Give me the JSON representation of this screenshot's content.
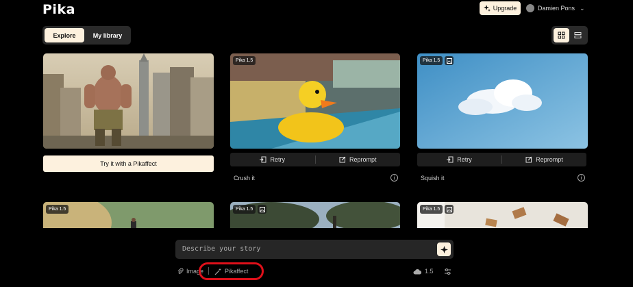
{
  "app": {
    "logo": "Pika"
  },
  "header": {
    "upgrade_label": "Upgrade",
    "user_name": "Damien Pons"
  },
  "tabs": [
    {
      "label": "Explore",
      "active": true
    },
    {
      "label": "My library",
      "active": false
    }
  ],
  "view_toggle": {
    "selected": "grid"
  },
  "cards": [
    {
      "badge": "",
      "cta_label": "Try it with a Pikaffect"
    },
    {
      "badge": "Pika 1.5",
      "has_image_icon": false,
      "retry_label": "Retry",
      "reprompt_label": "Reprompt",
      "caption": "Crush it"
    },
    {
      "badge": "Pika 1.5",
      "has_image_icon": true,
      "retry_label": "Retry",
      "reprompt_label": "Reprompt",
      "caption": "Squish it"
    },
    {
      "badge": "Pika 1.5",
      "has_image_icon": false
    },
    {
      "badge": "Pika 1.5",
      "has_image_icon": true
    },
    {
      "badge": "Pika 1.5",
      "has_image_icon": true
    }
  ],
  "prompt": {
    "placeholder": "Describe your story",
    "tool_image": "Image",
    "tool_pikaffect": "Pikaffect",
    "model_version": "1.5"
  },
  "colors": {
    "accent": "#fdf1de",
    "highlight_ring": "#e0101a",
    "background": "#000000"
  }
}
